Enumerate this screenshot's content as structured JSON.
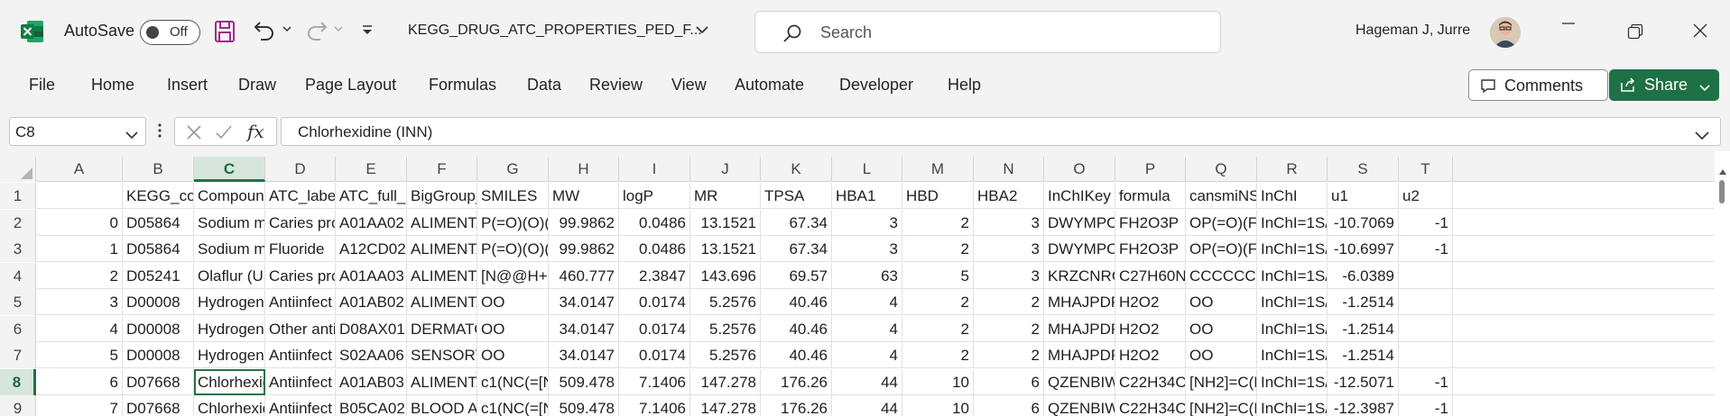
{
  "app": {
    "autosave_label": "AutoSave",
    "autosave_state": "Off",
    "file_title": "KEGG_DRUG_ATC_PROPERTIES_PED_F...",
    "user_name": "Hageman J, Jurre",
    "colors": {
      "brand": "#217346",
      "share_bg": "#1e7145",
      "selection": "#d7e6dc"
    }
  },
  "search": {
    "placeholder": "Search"
  },
  "menu": {
    "items": [
      "File",
      "Home",
      "Insert",
      "Draw",
      "Page Layout",
      "Formulas",
      "Data",
      "Review",
      "View",
      "Automate",
      "Developer",
      "Help"
    ],
    "comments_label": "Comments",
    "share_label": "Share"
  },
  "formula_bar": {
    "name_box": "C8",
    "fx_label": "fx",
    "value": "Chlorhexidine (INN)"
  },
  "sheet": {
    "columns": [
      "A",
      "B",
      "C",
      "D",
      "E",
      "F",
      "G",
      "H",
      "I",
      "J",
      "K",
      "L",
      "M",
      "N",
      "O",
      "P",
      "Q",
      "R",
      "S",
      "T"
    ],
    "active_column": "C",
    "active_row": "8",
    "rows": [
      {
        "num": "1",
        "cells": [
          "",
          "KEGG_code",
          "Compound",
          "ATC_label",
          "ATC_full_c",
          "BigGroup_",
          "SMILES",
          "MW",
          "logP",
          "MR",
          "TPSA",
          "HBA1",
          "HBD",
          "HBA2",
          "InChIKey",
          "formula",
          "cansmiNS",
          "InChI",
          "u1",
          "u2"
        ]
      },
      {
        "num": "2",
        "cells": [
          "0",
          "D05864",
          "Sodium m",
          "Caries pro",
          "A01AA02",
          "ALIMENTA",
          "P(=O)(O)(",
          "99.9862",
          "0.0486",
          "13.1521",
          "67.34",
          "3",
          "2",
          "3",
          "DWYMPO",
          "FH2O3P",
          "OP(=O)(F)",
          "InChI=1S/F",
          "-10.7069",
          "-1"
        ]
      },
      {
        "num": "3",
        "cells": [
          "1",
          "D05864",
          "Sodium m",
          "Fluoride",
          "A12CD02",
          "ALIMENTA",
          "P(=O)(O)(",
          "99.9862",
          "0.0486",
          "13.1521",
          "67.34",
          "3",
          "2",
          "3",
          "DWYMPO",
          "FH2O3P",
          "OP(=O)(F)",
          "InChI=1S/F",
          "-10.6997",
          "-1"
        ]
      },
      {
        "num": "4",
        "cells": [
          "2",
          "D05241",
          "Olaflur (US",
          "Caries pro",
          "A01AA03",
          "ALIMENTA",
          "[N@@H+](",
          "460.777",
          "2.3847",
          "143.696",
          "69.57",
          "63",
          "5",
          "3",
          "KRZCNRGN",
          "C27H60N2",
          "CCCCCCC",
          "InChI=1S/C",
          "-6.0389",
          ""
        ]
      },
      {
        "num": "5",
        "cells": [
          "3",
          "D00008",
          "Hydrogen",
          "Antiinfect",
          "A01AB02",
          "ALIMENTA",
          "OO",
          "34.0147",
          "0.0174",
          "5.2576",
          "40.46",
          "4",
          "2",
          "2",
          "MHAJPDPJ",
          "H2O2",
          "OO",
          "InChI=1S/H",
          "-1.2514",
          ""
        ]
      },
      {
        "num": "6",
        "cells": [
          "4",
          "D00008",
          "Hydrogen",
          "Other anti",
          "D08AX01",
          "DERMATO",
          "OO",
          "34.0147",
          "0.0174",
          "5.2576",
          "40.46",
          "4",
          "2",
          "2",
          "MHAJPDPJ",
          "H2O2",
          "OO",
          "InChI=1S/H",
          "-1.2514",
          ""
        ]
      },
      {
        "num": "7",
        "cells": [
          "5",
          "D00008",
          "Hydrogen",
          "Antiinfect",
          "S02AA06",
          "SENSORY",
          "OO",
          "34.0147",
          "0.0174",
          "5.2576",
          "40.46",
          "4",
          "2",
          "2",
          "MHAJPDPJ",
          "H2O2",
          "OO",
          "InChI=1S/H",
          "-1.2514",
          ""
        ]
      },
      {
        "num": "8",
        "cells": [
          "6",
          "D07668",
          "Chlorhexid",
          "Antiinfect",
          "A01AB03",
          "ALIMENTA",
          "c1(NC(=[N",
          "509.478",
          "7.1406",
          "147.278",
          "176.26",
          "44",
          "10",
          "6",
          "QZENBIWU",
          "C22H34Cl",
          "[NH2]=C(N",
          "InChI=1S/C",
          "-12.5071",
          "-1"
        ]
      },
      {
        "num": "9",
        "cells": [
          "7",
          "D07668",
          "Chlorhexid",
          "Antiinfect",
          "B05CA02",
          "BLOOD AN",
          "c1(NC(=[N",
          "509.478",
          "7.1406",
          "147.278",
          "176.26",
          "44",
          "10",
          "6",
          "QZENBIWU",
          "C22H34Cl",
          "[NH2]=C(N",
          "InChI=1S/C",
          "-12.3987",
          "-1"
        ]
      }
    ]
  }
}
